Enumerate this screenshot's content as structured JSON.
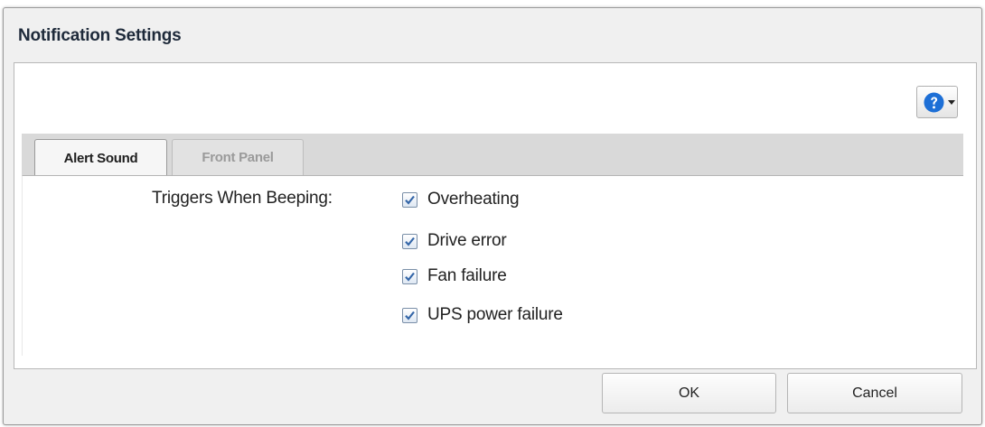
{
  "dialog": {
    "title": "Notification Settings",
    "help_icon": "question-circle-icon",
    "help_caret_icon": "chevron-down-icon"
  },
  "tabs": [
    {
      "label": "Alert Sound",
      "active": true
    },
    {
      "label": "Front Panel",
      "active": false
    }
  ],
  "alert_sound": {
    "triggers_label": "Triggers When Beeping:",
    "options": [
      {
        "label": "Overheating",
        "checked": true
      },
      {
        "label": "Drive error",
        "checked": true
      },
      {
        "label": "Fan failure",
        "checked": true
      },
      {
        "label": "UPS power failure",
        "checked": true
      }
    ]
  },
  "buttons": {
    "ok_label": "OK",
    "cancel_label": "Cancel"
  },
  "colors": {
    "help_icon_blue": "#1d6fd6",
    "check_mark": "#3466a8"
  }
}
